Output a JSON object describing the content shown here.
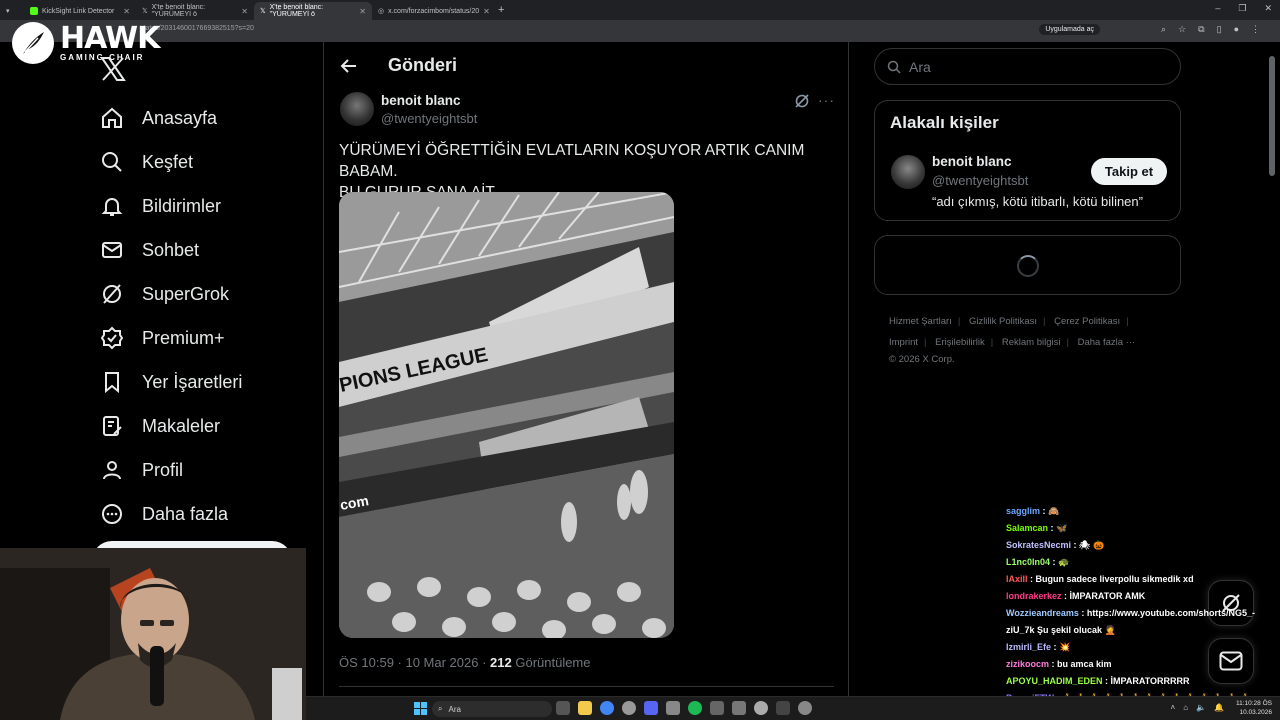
{
  "browser": {
    "tabs": [
      {
        "label": "KickSight Link Detector",
        "active": false
      },
      {
        "label": "X'te benoit blanc: \"YÜRÜMEYİ ö",
        "active": false
      },
      {
        "label": "X'te benoit blanc: \"YÜRÜMEYİ ö",
        "active": true
      },
      {
        "label": "x.com/forzacimbom/status/20",
        "active": false
      }
    ],
    "url": "status/2031460017669382515?s=20",
    "app_button": "Uygulamada aç"
  },
  "overlay_logo": {
    "title": "HAWK",
    "subtitle": "GAMING CHAIR"
  },
  "nav": {
    "items": [
      {
        "label": "Anasayfa",
        "icon": "home-icon"
      },
      {
        "label": "Keşfet",
        "icon": "search-icon"
      },
      {
        "label": "Bildirimler",
        "icon": "bell-icon"
      },
      {
        "label": "Sohbet",
        "icon": "mail-icon"
      },
      {
        "label": "SuperGrok",
        "icon": "grok-icon"
      },
      {
        "label": "Premium+",
        "icon": "verified-icon"
      },
      {
        "label": "Yer İşaretleri",
        "icon": "bookmark-icon"
      },
      {
        "label": "Makaleler",
        "icon": "article-icon"
      },
      {
        "label": "Profil",
        "icon": "person-icon"
      },
      {
        "label": "Daha fazla",
        "icon": "more-circle-icon"
      }
    ]
  },
  "post": {
    "header_title": "Gönderi",
    "author_name": "benoit blanc",
    "author_handle": "@twentyeightsbt",
    "text_line1": "YÜRÜMEYİ ÖĞRETTİĞİN EVLATLARIN KOŞUYOR ARTIK CANIM BABAM.",
    "text_line2": "BU GURUR SANA AİT.",
    "image_banner_text": "PIONS LEAGUE",
    "image_board_text": "com",
    "timestamp": "ÖS 10:59 · 10 Mar 2026 · ",
    "views": "212",
    "views_label": " Görüntüleme"
  },
  "sidebar": {
    "search_placeholder": "Ara",
    "related_title": "Alakalı kişiler",
    "related_name": "benoit blanc",
    "related_handle": "@twentyeightsbt",
    "related_bio": "“adı çıkmış, kötü itibarlı, kötü bilinen”",
    "follow_label": "Takip et",
    "footer_row1": [
      "Hizmet Şartları",
      "Gizlilik Politikası",
      "Çerez Politikası"
    ],
    "footer_row2": [
      "Imprint",
      "Erişilebilirlik",
      "Reklam bilgisi",
      "Daha fazla ···"
    ],
    "copyright": "© 2026 X Corp."
  },
  "chat": [
    {
      "user": "sagglim",
      "color": "#6aa8ff",
      "text": " : 🙈"
    },
    {
      "user": "Salamcan",
      "color": "#7cfc00",
      "text": " : 🦋"
    },
    {
      "user": "SokratesNecmi",
      "color": "#c0c0ff",
      "text": " : 🕷 🎃"
    },
    {
      "user": "L1nc0ln04",
      "color": "#9cff6a",
      "text": " : 🐢"
    },
    {
      "user": "lAxill",
      "color": "#ff5a5a",
      "text": " : Bugun sadece liverpollu sikmedik xd"
    },
    {
      "user": "londrakerkez",
      "color": "#ff3b8a",
      "text": " : İMPARATOR AMK"
    },
    {
      "user": "Wozzieandreams",
      "color": "#9ecbff",
      "text": " : https://www.youtube.com/shorts/NG5_-ziU_7k Şu şekil olucak 🤦"
    },
    {
      "user": "Izmirli_Efe",
      "color": "#b8b8ff",
      "text": " : 💥"
    },
    {
      "user": "zizikoocm",
      "color": "#ff7ad9",
      "text": " : bu amca kim"
    },
    {
      "user": "APOYU_HADIM_EDEN",
      "color": "#9cff4a",
      "text": " : İMPARATORRRRR"
    },
    {
      "user": "PacaciFTW",
      "color": "#8c7bff",
      "text": " : 🏃 🏃 🏃 🏃 🏃 🏃 🏃 🏃 🏃 🏃 🏃 🏃 🏃 🏃"
    }
  ],
  "taskbar": {
    "search_placeholder": "Ara",
    "time": "11:10:28 ÖS",
    "date": "10.03.2026"
  }
}
